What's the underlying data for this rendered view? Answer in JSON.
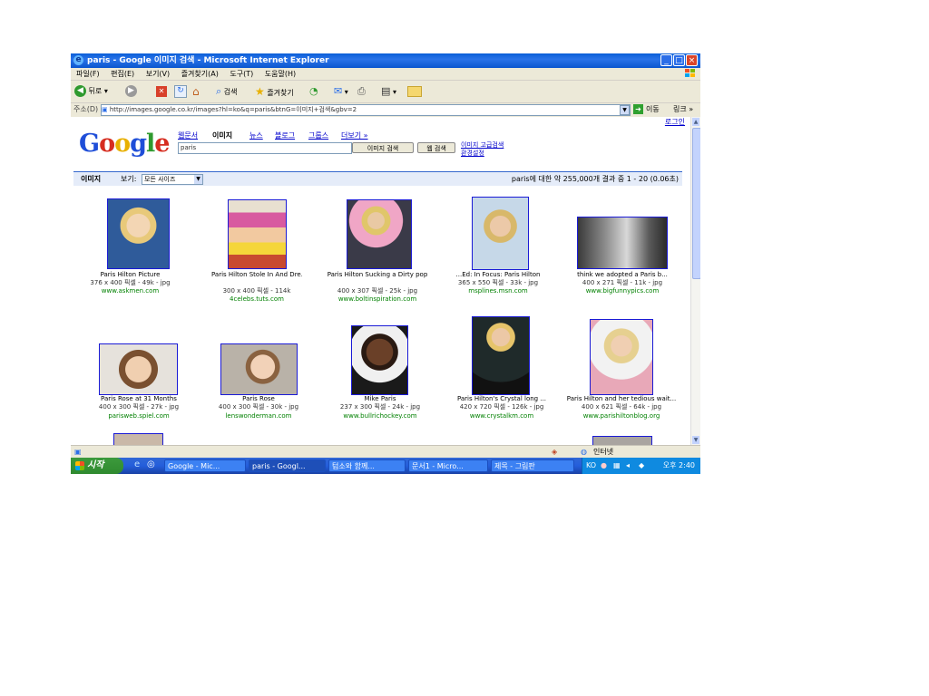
{
  "window": {
    "title": "paris - Google 이미지 검색 - Microsoft Internet Explorer",
    "controls": [
      "_",
      "□",
      "×"
    ]
  },
  "menu": [
    "파일(F)",
    "편집(E)",
    "보기(V)",
    "즐겨찾기(A)",
    "도구(T)",
    "도움말(H)"
  ],
  "toolbar": {
    "back": "뒤로",
    "search": "검색",
    "favorites": "즐겨찾기"
  },
  "address": {
    "label": "주소(D)",
    "url": "http://images.google.co.kr/images?hl=ko&q=paris&btnG=이미지+검색&gbv=2",
    "go": "이동",
    "links": "링크"
  },
  "google": {
    "logo": "Google",
    "login": "로그인",
    "nav": [
      "웹문서",
      "이미지",
      "뉴스",
      "블로그",
      "그룹스",
      "더보기 »"
    ],
    "query": "paris",
    "search_button": "이미지 검색",
    "web_button": "웹 검색",
    "advanced_links": [
      "이미지 고급검색",
      "환경설정"
    ],
    "results_title": "이미지",
    "show_label": "보기:",
    "size_select": "모든 사이즈",
    "results_count": "paris에 대한 약 255,000개 결과 중 1 - 20 (0.06초)"
  },
  "results": [
    {
      "title": "Paris Hilton Picture",
      "dims": "376 x 400 픽셀 - 49k - jpg",
      "site": "www.askmen.com"
    },
    {
      "title": "Paris Hilton Stole In And Dre...",
      "dims": "300 x 400 픽셀 - 114k",
      "site": "4celebs.tuts.com"
    },
    {
      "title": "Paris Hilton Sucking a Dirty pop",
      "dims": "400 x 307 픽셀 - 25k - jpg",
      "site": "www.boltinspiration.com"
    },
    {
      "title": "...Ed: In Focus: Paris Hilton",
      "dims": "365 x 550 픽셀 - 33k - jpg",
      "site": "msplines.msn.com"
    },
    {
      "title": "think we adopted a Paris b...",
      "dims": "400 x 271 픽셀 - 11k - jpg",
      "site": "www.bigfunnypics.com"
    },
    {
      "title": "Paris Rose at 31 Months",
      "dims": "400 x 300 픽셀 - 27k - jpg",
      "site": "parisweb.spiel.com"
    },
    {
      "title": "Paris Rose",
      "dims": "400 x 300 픽셀 - 30k - jpg",
      "site": "lenswonderman.com"
    },
    {
      "title": "Mike Paris",
      "dims": "237 x 300 픽셀 - 24k - jpg",
      "site": "www.bullrichockey.com"
    },
    {
      "title": "Paris Hilton's Crystal long ...",
      "dims": "420 x 720 픽셀 - 126k - jpg",
      "site": "www.crystalkm.com"
    },
    {
      "title": "Paris Hilton and her tedious wait...",
      "dims": "400 x 621 픽셀 - 64k - jpg",
      "site": "www.parishiltonblog.org"
    }
  ],
  "status": {
    "zone": "인터넷"
  },
  "taskbar": {
    "start": "시작",
    "tasks": [
      "Google - Mic...",
      "paris - Googl...",
      "텀소와 함께...",
      "문서1 - Micro...",
      "제목 - 그림판"
    ],
    "lang": "KO",
    "clock": "오후 2:40"
  },
  "colors": {
    "title_blue": "#0a5fd8",
    "link_blue": "#0000cc",
    "url_green": "#008000",
    "results_bar": "#e5ecf9"
  }
}
